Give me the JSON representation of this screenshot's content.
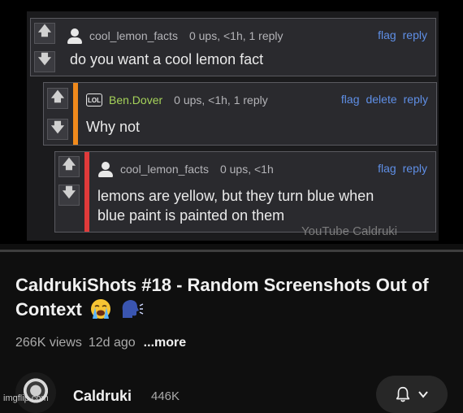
{
  "thread": {
    "comments": [
      {
        "username": "cool_lemon_facts",
        "meta": "0 ups, <1h, 1 reply",
        "actions": [
          "flag",
          "reply"
        ],
        "body_lines": [
          "do you want a cool lemon fact"
        ],
        "bar_color": "",
        "avatar": "person-icon"
      },
      {
        "username": "Ben.Dover",
        "meta": "0 ups, <1h, 1 reply",
        "actions": [
          "flag",
          "delete",
          "reply"
        ],
        "body_lines": [
          "Why not"
        ],
        "bar_color": "#f08a1c",
        "avatar": "lol-icon",
        "avatar_text": "LOL"
      },
      {
        "username": "cool_lemon_facts",
        "meta": "0 ups, <1h",
        "actions": [
          "flag",
          "reply"
        ],
        "body_lines": [
          "lemons are yellow, but they turn blue when",
          "blue paint is painted on them"
        ],
        "bar_color": "#e03a3a",
        "avatar": "person-icon"
      }
    ],
    "watermark": "YouTube Caldruki"
  },
  "video": {
    "progress": 0.0,
    "title": "CaldrukiShots #18 - Random Screenshots Out of Context",
    "title_emojis": [
      "loudly-crying-face-icon",
      "speaking-head-icon"
    ],
    "views": "266K views",
    "age": "12d ago",
    "more": "...more"
  },
  "channel": {
    "name": "Caldruki",
    "subscribers": "446K",
    "bell": "bell-icon",
    "chevron": "chevron-down-icon"
  },
  "footer": {
    "imgflip": "imgflip.com"
  },
  "colors": {
    "link": "#5f8fe6",
    "username_green": "#a6d35a",
    "background": "#0f0f0f"
  }
}
